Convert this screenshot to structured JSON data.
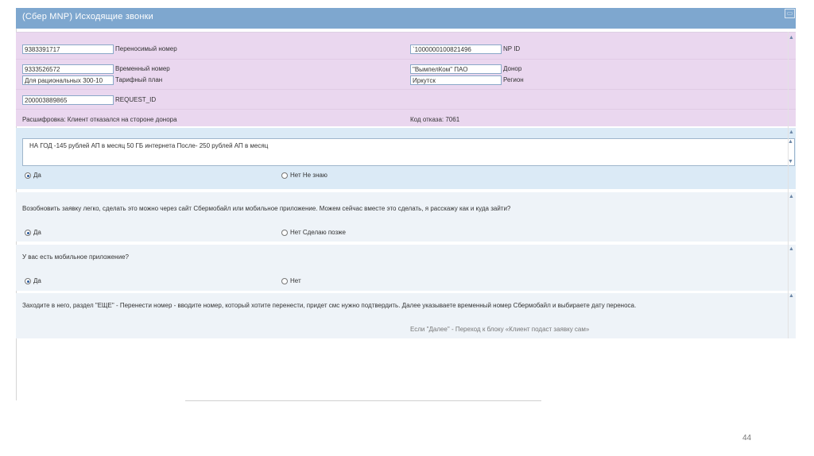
{
  "window": {
    "title": "(Сбер MNP) Исходящие звонки",
    "control": "▭"
  },
  "form": {
    "ported_number": {
      "value": "9383391717",
      "label": "Переносимый номер"
    },
    "np_id": {
      "value": "`1000000100821496",
      "label": "NP ID"
    },
    "temp_number": {
      "value": "9333526572",
      "label": "Временный номер"
    },
    "donor": {
      "value": "\"ВымпелКом\" ПАО",
      "label": "Донор"
    },
    "tariff": {
      "value": "Для рациональных 300-10",
      "label": "Тарифный план"
    },
    "region": {
      "value": "Иркутск",
      "label": "Регион"
    },
    "request_id": {
      "value": "200003889865",
      "label": "REQUEST_ID"
    },
    "decoding": "Расшифровка: Клиент отказался на стороне донора",
    "reject_code": "Код отказа: 7061"
  },
  "offer": {
    "text": "НА ГОД -145 рублей АП в месяц 50 ГБ интернета После- 250 рублей АП в месяц",
    "options": [
      {
        "label": "Да",
        "selected": true
      },
      {
        "label": "Нет  Не знаю",
        "selected": false
      }
    ]
  },
  "question1": {
    "text": "Возобновить заявку легко, сделать это можно через сайт Сбермобайл или мобильное приложение. Можем сейчас вместе это сделать, я расскажу как и куда зайти?",
    "options": [
      {
        "label": "Да",
        "selected": true
      },
      {
        "label": "Нет  Сделаю позже",
        "selected": false
      }
    ]
  },
  "question2": {
    "text": "У вас есть мобильное приложение?",
    "options": [
      {
        "label": "Да",
        "selected": true
      },
      {
        "label": "Нет",
        "selected": false
      }
    ]
  },
  "info": {
    "text": "Заходите в него, раздел \"ЕЩЕ\" - Перенести номер - вводите номер, который хотите перенести, придет смс нужно подтвердить. Далее указываете временный номер Сбермобайл и выбираете дату переноса.",
    "footer": "Если \"Далее\" - Переход к блоку «Клиент подаст заявку сам»"
  },
  "scroll_glyphs": {
    "up": "▲",
    "down": "▼"
  },
  "page_number": "44"
}
